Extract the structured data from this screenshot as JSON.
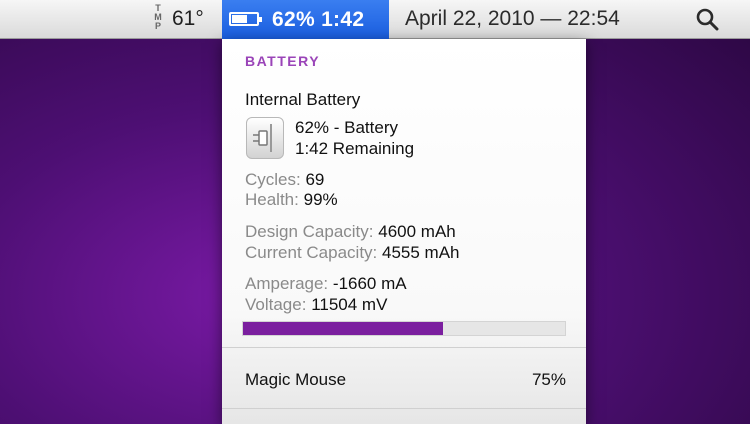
{
  "menubar": {
    "temp_icon_letters": "TMP",
    "temperature": "61°",
    "battery_menu_text": "62% 1:42",
    "battery_level_fraction": 0.62,
    "datetime": "April 22, 2010 — 22:54",
    "search_icon": "magnifying-glass",
    "battery_highlight_color": "#2a6ee8"
  },
  "panel": {
    "section_title": "BATTERY",
    "device_name": "Internal Battery",
    "plug_icon": "power-plug",
    "status_line1": "62% - Battery",
    "status_line2": "1:42 Remaining",
    "cycles_label": "Cycles:",
    "cycles_value": "69",
    "health_label": "Health:",
    "health_value": "99%",
    "design_capacity_label": "Design Capacity:",
    "design_capacity_value": "4600 mAh",
    "current_capacity_label": "Current Capacity:",
    "current_capacity_value": "4555 mAh",
    "amperage_label": "Amperage:",
    "amperage_value": "-1660 mA",
    "voltage_label": "Voltage:",
    "voltage_value": "11504 mV",
    "charge_bar_fraction": 0.62,
    "charge_bar_color": "#7b1f9f",
    "accessory_name": "Magic Mouse",
    "accessory_level": "75%"
  }
}
